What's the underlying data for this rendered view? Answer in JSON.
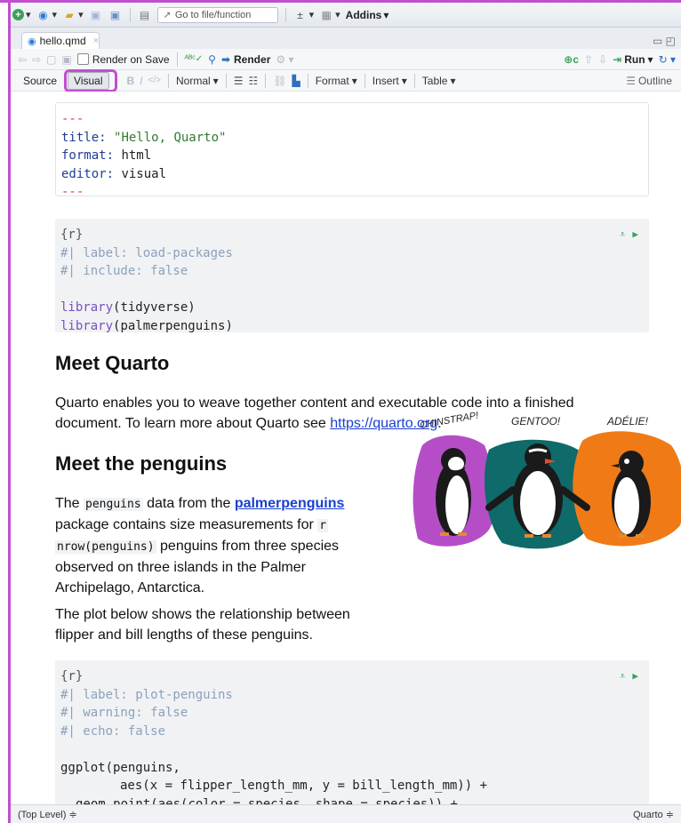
{
  "toolbar": {
    "goto_placeholder": "Go to file/function",
    "addins_label": "Addins"
  },
  "tabs": [
    {
      "label": "hello.qmd"
    }
  ],
  "editor_toolbar": {
    "render_on_save": "Render on Save",
    "render_label": "Render",
    "run_label": "Run"
  },
  "visual_toolbar": {
    "source": "Source",
    "visual": "Visual",
    "style": "Normal",
    "format": "Format",
    "insert": "Insert",
    "table": "Table",
    "outline": "Outline"
  },
  "yaml": {
    "delim": "---",
    "title_key": "title:",
    "title_value": "\"Hello, Quarto\"",
    "format_key": "format:",
    "format_value": "html",
    "editor_key": "editor:",
    "editor_value": "visual"
  },
  "chunk1": {
    "header": "{r}",
    "comment1": "#| label: load-packages",
    "comment2": "#| include: false",
    "fn": "library",
    "arg1": "(tidyverse)",
    "arg2": "(palmerpenguins)"
  },
  "section1": {
    "heading": "Meet Quarto",
    "text_line1": "Quarto enables you to weave together content and executable code into a finished",
    "text_line2": "document. To learn more about Quarto see ",
    "link": "https://quarto.org",
    "after_link": "."
  },
  "section2": {
    "heading": "Meet the penguins",
    "p1_start": "The ",
    "p1_code": "penguins",
    "p1_mid": " data from the ",
    "p1_link": "palmerpenguins",
    "p1_line2": "package contains size measurements for ",
    "p1_code2": "r",
    "p1_code3": "nrow(penguins)",
    "p1_line3_end": " penguins from three species",
    "p1_line4": "observed on three islands in the Palmer",
    "p1_line5": "Archipelago, Antarctica.",
    "p2_line1": "The plot below shows the relationship between",
    "p2_line2": "flipper and bill lengths of these penguins."
  },
  "penguin_art": {
    "label_chinstrap": "CHINSTRAP!",
    "label_gentoo": "GENTOO!",
    "label_adelie": "ADÉLIE!",
    "colors": {
      "chinstrap": "#b54ec6",
      "gentoo": "#0f6a6a",
      "adelie": "#f07b16"
    }
  },
  "chunk2": {
    "header": "{r}",
    "comment1": "#| label: plot-penguins",
    "comment2": "#| warning: false",
    "comment3": "#| echo: false",
    "line1_fn": "ggplot",
    "line1_rest": "(penguins,",
    "line2_fn": "aes",
    "line2_rest": "(x = flipper_length_mm, y = bill_length_mm)) +",
    "line3_fn": "geom_point",
    "line3_mid": "(",
    "line3_fn2": "aes",
    "line3_rest": "(color = species, shape = species)) +"
  },
  "statusbar": {
    "scope": "(Top Level) ≑",
    "mode": "Quarto ≑"
  }
}
